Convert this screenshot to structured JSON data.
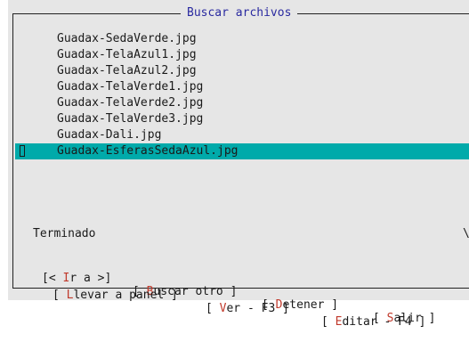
{
  "dialog": {
    "title": "Buscar archivos"
  },
  "files": [
    "Guadax-SedaVerde.jpg",
    "Guadax-TelaAzul1.jpg",
    "Guadax-TelaAzul2.jpg",
    "Guadax-TelaVerde1.jpg",
    "Guadax-TelaVerde2.jpg",
    "Guadax-TelaVerde3.jpg",
    "Guadax-Dali.jpg",
    "Guadax-EsferasSedaAzul.jpg"
  ],
  "selected_index": 7,
  "status": {
    "text": "Terminado",
    "spinner": "\\"
  },
  "buttons": {
    "goto": {
      "pre": "[< ",
      "hot": "I",
      "post": "r a >]"
    },
    "search_again": {
      "pre": "[ ",
      "hot": "B",
      "post": "uscar otro ]"
    },
    "stop": {
      "pre": "[ ",
      "hot": "D",
      "post": "etener ]"
    },
    "quit": {
      "pre": "[ ",
      "hot": "S",
      "post": "alir ]"
    },
    "panelize": {
      "pre": "[ ",
      "hot": "L",
      "post": "levar a panel ]"
    },
    "view": {
      "pre": "[ ",
      "hot": "V",
      "post": "er - F3 ]"
    },
    "edit": {
      "pre": "[ ",
      "hot": "E",
      "post": "ditar - F4 ]"
    }
  },
  "colors": {
    "selection": "#00aaaa",
    "title": "#2a2aa0",
    "hotkey": "#c0392b",
    "background": "#e6e6e6"
  }
}
